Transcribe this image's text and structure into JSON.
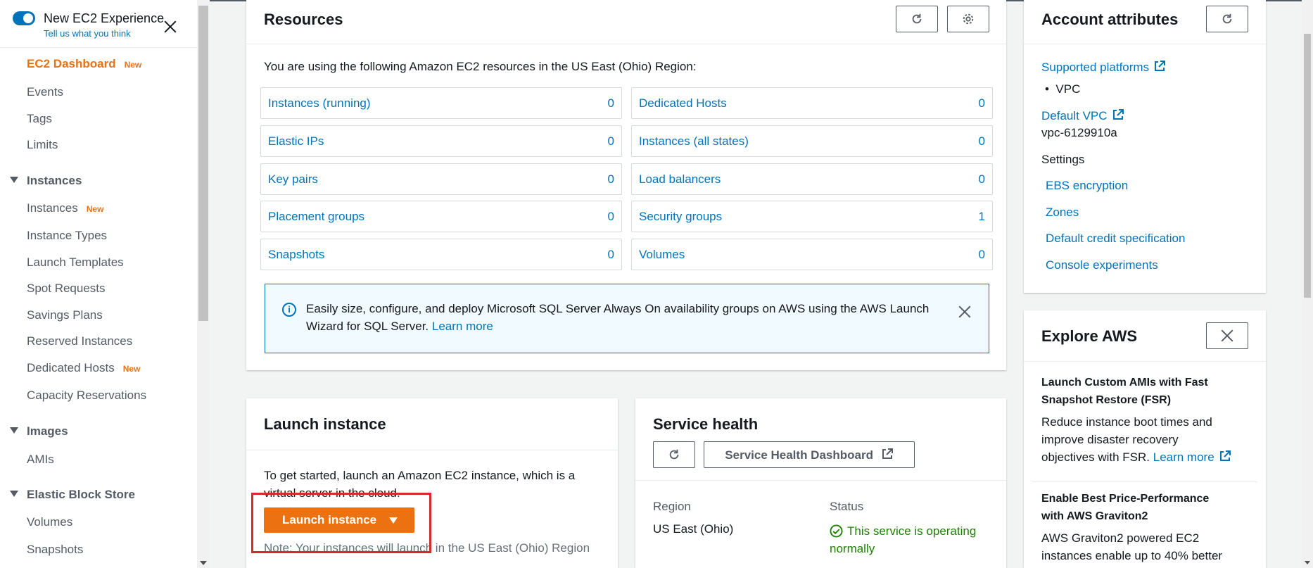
{
  "experience": {
    "title": "New EC2 Experience",
    "subtitle": "Tell us what you think"
  },
  "sidebar": {
    "dashboard": {
      "label": "EC2 Dashboard",
      "badge": "New"
    },
    "items_top": [
      "Events",
      "Tags",
      "Limits"
    ],
    "sections": [
      {
        "label": "Instances",
        "items": [
          {
            "label": "Instances",
            "badge": "New"
          },
          {
            "label": "Instance Types"
          },
          {
            "label": "Launch Templates"
          },
          {
            "label": "Spot Requests"
          },
          {
            "label": "Savings Plans"
          },
          {
            "label": "Reserved Instances"
          },
          {
            "label": "Dedicated Hosts",
            "badge": "New"
          },
          {
            "label": "Capacity Reservations"
          }
        ]
      },
      {
        "label": "Images",
        "items": [
          {
            "label": "AMIs"
          }
        ]
      },
      {
        "label": "Elastic Block Store",
        "items": [
          {
            "label": "Volumes"
          },
          {
            "label": "Snapshots"
          }
        ]
      }
    ]
  },
  "resources": {
    "title": "Resources",
    "intro": "You are using the following Amazon EC2 resources in the US East (Ohio) Region:",
    "left": [
      {
        "label": "Instances (running)",
        "value": "0"
      },
      {
        "label": "Elastic IPs",
        "value": "0"
      },
      {
        "label": "Key pairs",
        "value": "0"
      },
      {
        "label": "Placement groups",
        "value": "0"
      },
      {
        "label": "Snapshots",
        "value": "0"
      }
    ],
    "right": [
      {
        "label": "Dedicated Hosts",
        "value": "0"
      },
      {
        "label": "Instances (all states)",
        "value": "0"
      },
      {
        "label": "Load balancers",
        "value": "0"
      },
      {
        "label": "Security groups",
        "value": "1"
      },
      {
        "label": "Volumes",
        "value": "0"
      }
    ],
    "banner": {
      "text": "Easily size, configure, and deploy Microsoft SQL Server Always On availability groups on AWS using the AWS Launch Wizard for SQL Server.",
      "link": "Learn more"
    }
  },
  "launch": {
    "title": "Launch instance",
    "intro": "To get started, launch an Amazon EC2 instance, which is a virtual server in the cloud.",
    "button": "Launch instance",
    "note": "Note: Your instances will launch in the US East (Ohio) Region"
  },
  "health": {
    "title": "Service health",
    "dashboard_button": "Service Health Dashboard",
    "region_label": "Region",
    "region_value": "US East (Ohio)",
    "status_label": "Status",
    "status_value": "This service is operating normally"
  },
  "account": {
    "title": "Account attributes",
    "supported_platforms": "Supported platforms",
    "platform_vpc": "VPC",
    "default_vpc": "Default VPC",
    "vpc_id": "vpc-6129910a",
    "settings": "Settings",
    "links": [
      "EBS encryption",
      "Zones",
      "Default credit specification",
      "Console experiments"
    ]
  },
  "explore": {
    "title": "Explore AWS",
    "items": [
      {
        "heading": "Launch Custom AMIs with Fast Snapshot Restore (FSR)",
        "body": "Reduce instance boot times and improve disaster recovery objectives with FSR.",
        "link": "Learn more"
      },
      {
        "heading": "Enable Best Price-Performance with AWS Graviton2",
        "body": "AWS Graviton2 powered EC2 instances enable up to 40% better"
      }
    ]
  },
  "colors": {
    "accent": "#ec7211",
    "link": "#0073bb",
    "success": "#1d8102",
    "highlight": "#d9282f"
  }
}
